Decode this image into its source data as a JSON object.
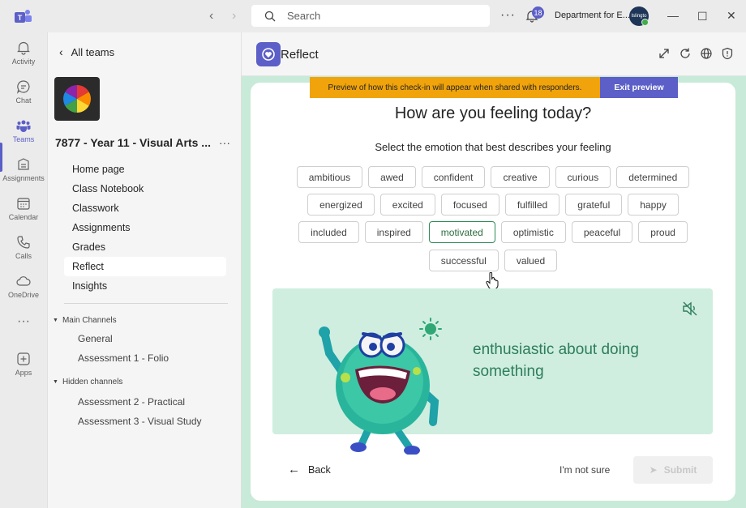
{
  "titlebar": {
    "search_placeholder": "Search",
    "notification_count": "18",
    "org_name": "Department for E...",
    "avatar_text": "Islingto"
  },
  "rail": {
    "items": [
      {
        "label": "Activity",
        "icon": "bell-icon"
      },
      {
        "label": "Chat",
        "icon": "chat-icon"
      },
      {
        "label": "Teams",
        "icon": "teams-icon"
      },
      {
        "label": "Assignments",
        "icon": "assignments-icon"
      },
      {
        "label": "Calendar",
        "icon": "calendar-icon"
      },
      {
        "label": "Calls",
        "icon": "phone-icon"
      },
      {
        "label": "OneDrive",
        "icon": "cloud-icon"
      },
      {
        "label": "Apps",
        "icon": "apps-icon"
      }
    ]
  },
  "sidebar": {
    "back_label": "All teams",
    "team_name": "7877 - Year 11 - Visual Arts ...",
    "nav": [
      "Home page",
      "Class Notebook",
      "Classwork",
      "Assignments",
      "Grades",
      "Reflect",
      "Insights"
    ],
    "active_nav": "Reflect",
    "main_channels_label": "Main Channels",
    "main_channels": [
      "General",
      "Assessment 1 - Folio"
    ],
    "hidden_channels_label": "Hidden channels",
    "hidden_channels": [
      "Assessment 2 - Practical",
      "Assessment 3 - Visual Study"
    ]
  },
  "app": {
    "title": "Reflect",
    "preview_banner": "Preview of how this check-in will appear when shared with responders.",
    "exit_preview": "Exit preview",
    "question": "How are you feeling today?",
    "instruction": "Select the emotion that best describes your feeling",
    "emotion_rows": [
      [
        "ambitious",
        "awed",
        "confident",
        "creative",
        "curious",
        "determined"
      ],
      [
        "energized",
        "excited",
        "focused",
        "fulfilled",
        "grateful",
        "happy"
      ],
      [
        "included",
        "inspired",
        "motivated",
        "optimistic",
        "peaceful",
        "proud"
      ],
      [
        "successful",
        "valued"
      ]
    ],
    "selected_emotion": "motivated",
    "feeling_description": "enthusiastic about doing something",
    "back_label": "Back",
    "not_sure_label": "I'm not sure",
    "submit_label": "Submit"
  },
  "colors": {
    "accent": "#5b5fc7",
    "banner": "#f0a30a",
    "panel": "#cfeee0",
    "main_bg": "#c8ead8",
    "selected": "#2e8b57"
  }
}
